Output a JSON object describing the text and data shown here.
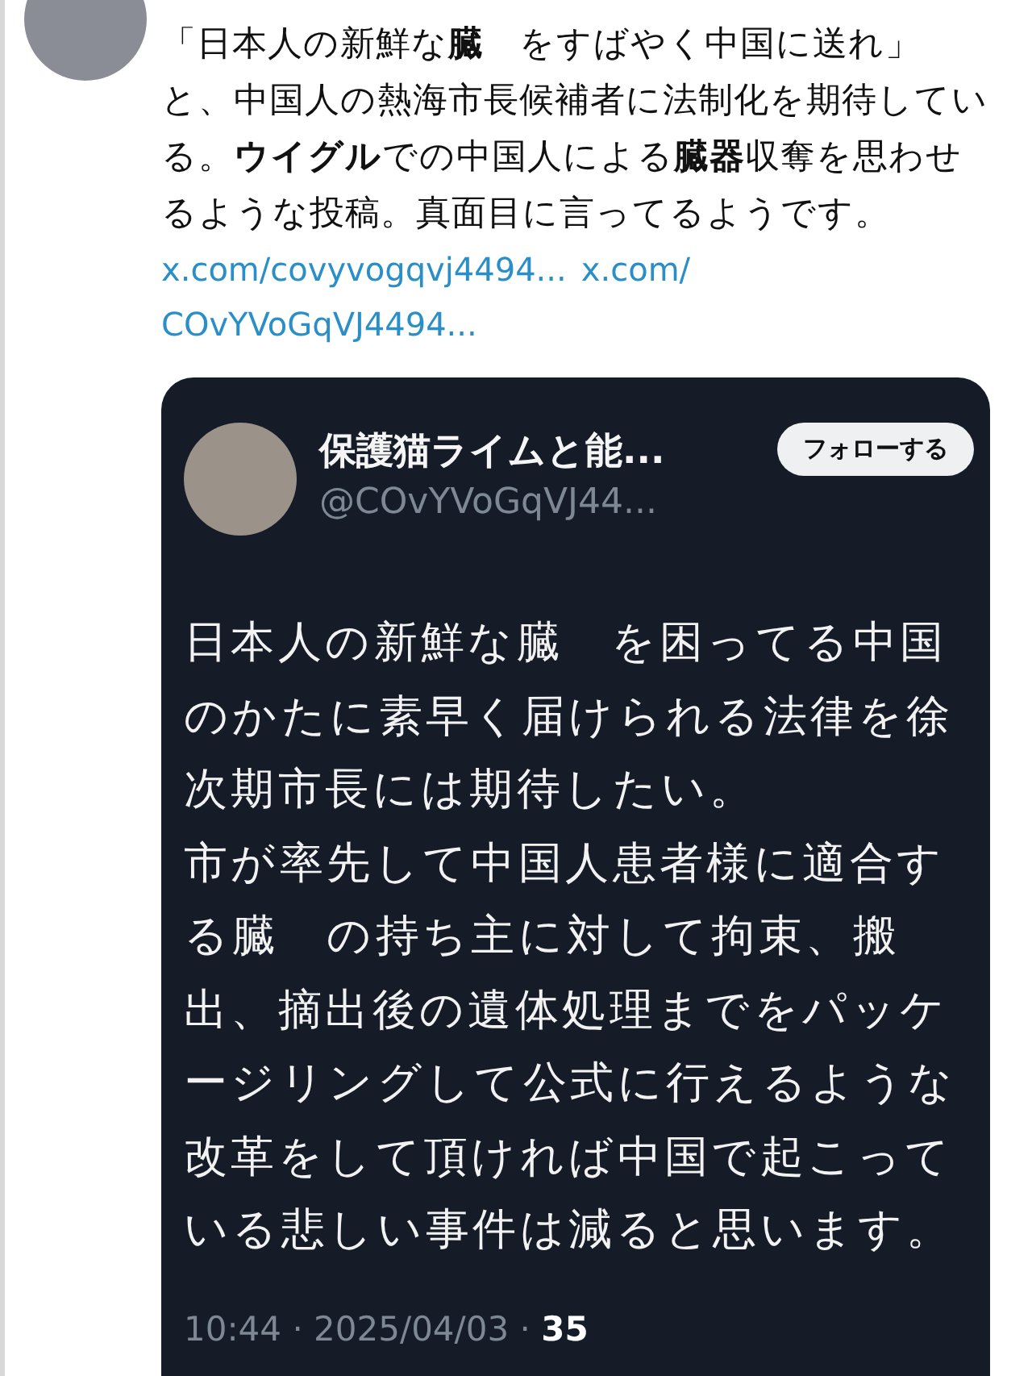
{
  "post": {
    "lines": [
      "「日本人の新鮮な**臓**　をすばやく中国に送れ」",
      "と、中国人の熱海市長候補者に法制化を期待している。**ウイグル**での中国人による**臓器**収奪を思わせるような投稿。真面目に言ってるようです。"
    ],
    "links": [
      "x.com/covyvogqvj4494...",
      "x.com/",
      "COvYVoGqVJ4494..."
    ]
  },
  "quote": {
    "name": "保護猫ライムと能...",
    "handle": "@COvYVoGqVJ44...",
    "follow_button": "フォローする",
    "paragraphs": [
      "日本人の新鮮な臓　を困ってる中国のかたに素早く届けられる法律を徐次期市長には期待したい。",
      "市が率先して中国人患者様に適合する臓　の持ち主に対して拘束、搬出、摘出後の遺体処理までをパッケージリングして公式に行えるような改革をして頂ければ中国で起こっている悲しい事件は減ると思います。"
    ],
    "meta": "10:44 · 2025/04/03 · ",
    "count": "35"
  }
}
